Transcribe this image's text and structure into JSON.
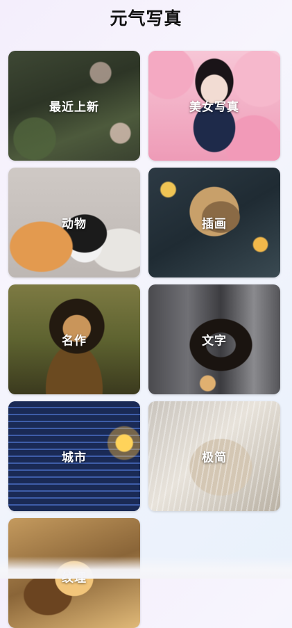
{
  "page": {
    "title": "元气写真"
  },
  "categories": [
    {
      "label": "最近上新",
      "art": "flower-garden-photo"
    },
    {
      "label": "美女写真",
      "art": "girl-cherry-blossom-photo"
    },
    {
      "label": "动物",
      "art": "cats-photo"
    },
    {
      "label": "插画",
      "art": "hooded-figure-illustration"
    },
    {
      "label": "名作",
      "art": "mona-lisa-painting"
    },
    {
      "label": "文字",
      "art": "tiktok-logo-3d"
    },
    {
      "label": "城市",
      "art": "city-building-night-photo"
    },
    {
      "label": "极简",
      "art": "minimal-folds-art"
    },
    {
      "label": "纹理",
      "art": "gold-texture-art"
    }
  ]
}
